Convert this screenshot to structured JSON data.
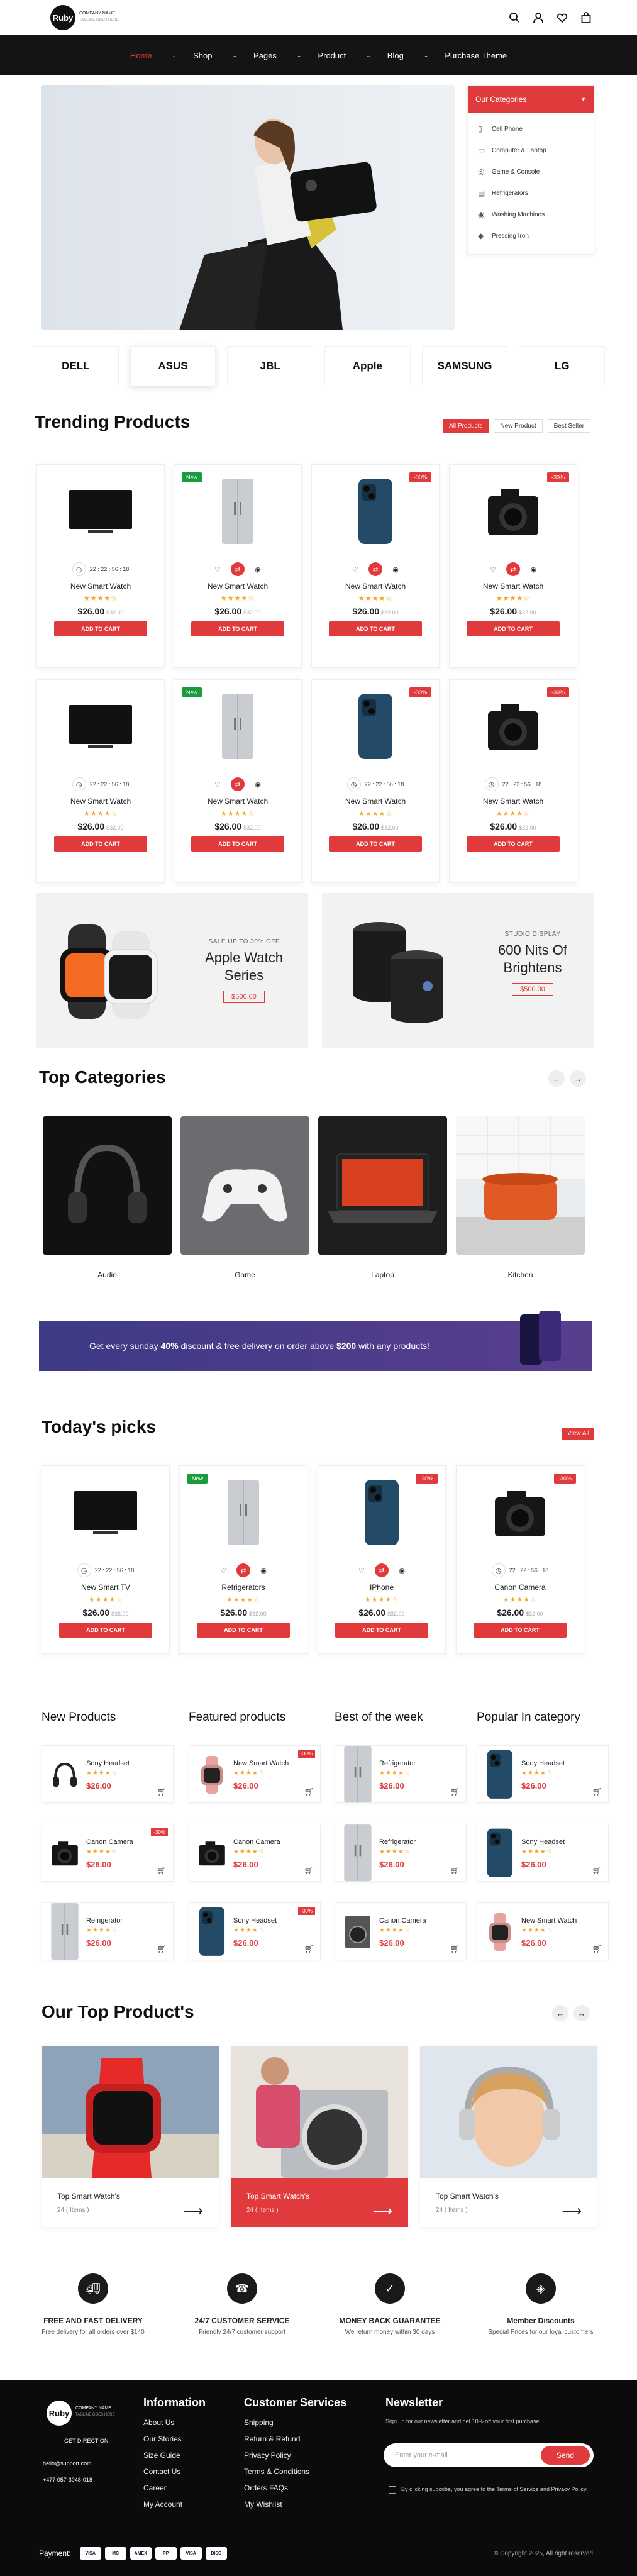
{
  "header": {
    "logo": "Ruby",
    "company": "COMPANY NAME",
    "tagline": "TAGLINE GOES HERE",
    "icons": [
      "search-icon",
      "user-icon",
      "heart-icon",
      "bag-icon"
    ]
  },
  "nav": [
    {
      "label": "Home",
      "active": true
    },
    {
      "label": "Shop"
    },
    {
      "label": "Pages"
    },
    {
      "label": "Product"
    },
    {
      "label": "Blog"
    },
    {
      "label": "Purchase Theme",
      "nochev": true
    }
  ],
  "categories_panel": {
    "title": "Our Categories",
    "items": [
      "Cell Phone",
      "Computer & Laptop",
      "Game & Console",
      "Refrigerators",
      "Washing Machines",
      "Pressing Iron"
    ]
  },
  "brands": [
    "DELL",
    "ASUS",
    "JBL",
    "Apple",
    "SAMSUNG",
    "LG"
  ],
  "trending": {
    "title": "Trending Products",
    "tabs": [
      "All Products",
      "New Product",
      "Best Seller"
    ],
    "products": [
      {
        "name": "New Smart Watch",
        "price": "$26.00",
        "old": "$32.00",
        "timer": "22 : 22 : 56 : 18",
        "img": "tv"
      },
      {
        "name": "New Smart Watch",
        "price": "$26.00",
        "old": "$32.00",
        "badge": "New",
        "img": "fridge"
      },
      {
        "name": "New Smart Watch",
        "price": "$26.00",
        "old": "$32.00",
        "badge": "-30%",
        "img": "phone"
      },
      {
        "name": "New Smart Watch",
        "price": "$26.00",
        "old": "$32.00",
        "badge": "-30%",
        "img": "camera"
      },
      {
        "name": "New Smart Watch",
        "price": "$26.00",
        "old": "$32.00",
        "timer": "22 : 22 : 56 : 18",
        "img": "tv"
      },
      {
        "name": "New Smart Watch",
        "price": "$26.00",
        "old": "$32.00",
        "badge": "New",
        "img": "fridge"
      },
      {
        "name": "New Smart Watch",
        "price": "$26.00",
        "old": "$32.00",
        "badge": "-30%",
        "timer": "22 : 22 : 56 : 18",
        "img": "phone"
      },
      {
        "name": "New Smart Watch",
        "price": "$26.00",
        "old": "$32.00",
        "badge": "-30%",
        "timer": "22 : 22 : 56 : 18",
        "img": "camera"
      }
    ],
    "add_label": "ADD TO CART"
  },
  "promos": [
    {
      "small": "SALE UP TO 30% OFF",
      "title": "Apple Watch Series",
      "price": "$500.00"
    },
    {
      "small": "STUDIO DISPLAY",
      "title": "600 Nits Of Brightens",
      "price": "$500.00"
    }
  ],
  "top_categories": {
    "title": "Top Categories",
    "items": [
      "Audio",
      "Game",
      "Laptop",
      "Kitchen"
    ]
  },
  "banner": {
    "pre": "Get every sunday ",
    "pct": "40%",
    "mid": " discount & free delivery on order above ",
    "amt": "$200",
    "post": " with any products!"
  },
  "picks": {
    "title": "Today's picks",
    "view_all": "View All",
    "products": [
      {
        "name": "New Smart TV",
        "price": "$26.00",
        "old": "$32.00",
        "timer": "22 : 22 : 56 : 18",
        "img": "tv"
      },
      {
        "name": "Refrigerators",
        "price": "$26.00",
        "old": "$32.00",
        "badge": "New",
        "img": "fridge"
      },
      {
        "name": "IPhone",
        "price": "$26.00",
        "old": "$32.00",
        "badge": "-30%",
        "img": "phone"
      },
      {
        "name": "Canon Camera",
        "price": "$26.00",
        "old": "$32.00",
        "badge": "-30%",
        "timer": "22 : 22 : 56 : 18",
        "img": "camera"
      }
    ]
  },
  "columns": [
    {
      "title": "New Products",
      "items": [
        {
          "name": "Sony Headset",
          "price": "$26.00",
          "img": "headset"
        },
        {
          "name": "Canon Camera",
          "price": "$26.00",
          "img": "camera",
          "badge": "-30%"
        },
        {
          "name": "Refrigerator",
          "price": "$26.00",
          "img": "fridge"
        }
      ]
    },
    {
      "title": "Featured products",
      "items": [
        {
          "name": "New Smart Watch",
          "price": "$26.00",
          "img": "watch",
          "badge": "-30%"
        },
        {
          "name": "Canon Camera",
          "price": "$26.00",
          "img": "camera"
        },
        {
          "name": "Sony Headset",
          "price": "$26.00",
          "img": "phone",
          "badge": "-30%"
        }
      ]
    },
    {
      "title": "Best of the week",
      "items": [
        {
          "name": "Refrigerator",
          "price": "$26.00",
          "img": "fridge"
        },
        {
          "name": "Refrigerator",
          "price": "$26.00",
          "img": "fridge"
        },
        {
          "name": "Canon Camera",
          "price": "$26.00",
          "img": "washer"
        }
      ]
    },
    {
      "title": "Popular In category",
      "items": [
        {
          "name": "Sony Headset",
          "price": "$26.00",
          "img": "phone"
        },
        {
          "name": "Sony Headset",
          "price": "$26.00",
          "img": "phone"
        },
        {
          "name": "New Smart Watch",
          "price": "$26.00",
          "img": "watch"
        }
      ]
    }
  ],
  "top_products": {
    "title": "Our Top Product's",
    "items": [
      {
        "name": "Top Smart Watch's",
        "count": "24 ( Items )",
        "img": "watch"
      },
      {
        "name": "Top Smart Watch's",
        "count": "24 ( Items )",
        "img": "washer",
        "highlight": true
      },
      {
        "name": "Top Smart Watch's",
        "count": "24 ( Items )",
        "img": "girl"
      }
    ]
  },
  "features": [
    {
      "title": "FREE AND FAST DELIVERY",
      "desc": "Free delivery for all orders over $140"
    },
    {
      "title": "24/7 CUSTOMER SERVICE",
      "desc": "Friendly 24/7 customer support"
    },
    {
      "title": "MONEY BACK GUARANTEE",
      "desc": "We return money within 30 days"
    },
    {
      "title": "Member Discounts",
      "desc": "Special Prices for our loyal customers"
    }
  ],
  "footer": {
    "logo": "Ruby",
    "company": "COMPANY NAME",
    "tagline": "TAGLINE GOES HERE",
    "direction": "GET DIRECTION",
    "email": "hello@support.com",
    "phone": "+477 057-3048-018",
    "info_title": "Information",
    "info": [
      "About Us",
      "Our Stories",
      "Size Guide",
      "Contact Us",
      "Career",
      "My Account"
    ],
    "cs_title": "Customer Services",
    "cs": [
      "Shipping",
      "Return & Refund",
      "Privacy Policy",
      "Terms & Conditions",
      "Orders FAQs",
      "My Wishlist"
    ],
    "nl_title": "Newsletter",
    "nl_desc": "Sign up for our newsletter and get 10% off your first purchase",
    "nl_placeholder": "Enter your e-mail",
    "nl_button": "Send",
    "nl_consent": "By clicking subcribe, you agree to the Terms of Service and Privacy Policy.",
    "payment_label": "Payment:",
    "cards": [
      "VISA",
      "MC",
      "AMEX",
      "PP",
      "VISA",
      "DISC"
    ],
    "copyright": "Copyright 2025, All right reserved"
  }
}
